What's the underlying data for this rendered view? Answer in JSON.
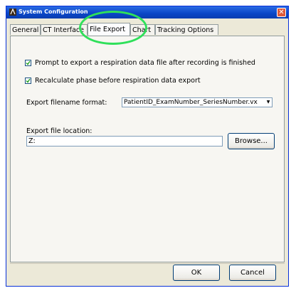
{
  "window": {
    "title": "System Configuration"
  },
  "tabs": [
    {
      "label": "General"
    },
    {
      "label": "CT Interface"
    },
    {
      "label": "File Export",
      "active": true
    },
    {
      "label": "Chart"
    },
    {
      "label": "Tracking Options"
    }
  ],
  "file_export": {
    "prompt_export": {
      "label": "Prompt to export a respiration data file after recording is finished",
      "checked": true
    },
    "recalculate_phase": {
      "label": "Recalculate phase before respiration data export",
      "checked": true
    },
    "filename_format_label": "Export filename format:",
    "filename_format_value": "PatientID_ExamNumber_SeriesNumber.vx",
    "location_label": "Export file location:",
    "location_value": "Z:",
    "browse_label": "Browse..."
  },
  "buttons": {
    "ok_label": "OK",
    "cancel_label": "Cancel"
  },
  "colors": {
    "titlebar": "#0a46c6",
    "highlight_ring": "#2fe05a",
    "background": "#ece9d8"
  }
}
